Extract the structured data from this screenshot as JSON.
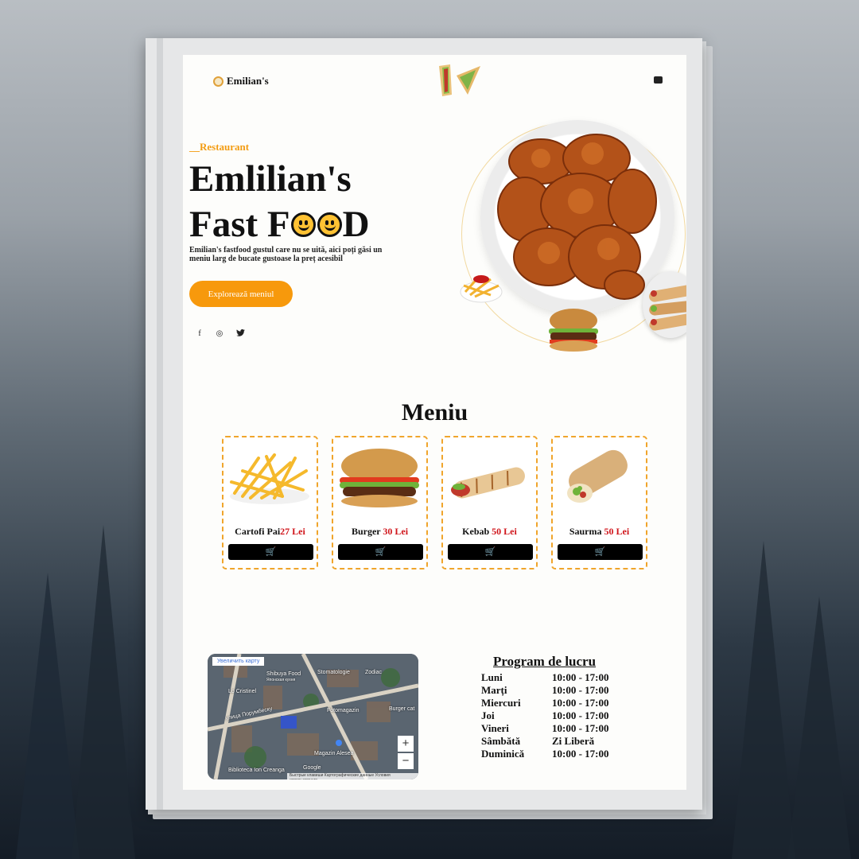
{
  "header": {
    "brand": "Emilian's"
  },
  "hero": {
    "eyebrow": "__Restaurant",
    "title_line1": "Emlilian's",
    "title_line2_start": "Fast F",
    "title_line2_end": "D",
    "description": "Emilian's fastfood gustul care nu se uită, aici poți găsi un meniu larg de bucate gustoase la preț acesibil",
    "cta_label": "Explorează meniul"
  },
  "social": {
    "facebook": "f",
    "instagram": "◎",
    "twitter": "🐦"
  },
  "menu": {
    "title": "Meniu",
    "items": [
      {
        "name": "Cartofi Pai",
        "price": "27 Lei"
      },
      {
        "name": "Burger ",
        "price": "30 Lei"
      },
      {
        "name": "Kebab ",
        "price": "50 Lei"
      },
      {
        "name": "Saurma ",
        "price": "50 Lei"
      }
    ],
    "cart_icon": "🛒"
  },
  "map": {
    "enlarge_label": "Увеличить карту",
    "labels": [
      "Shibuya Food",
      "Японская кухня",
      "Stomatologie",
      "Zodiac",
      "Lo Cristinel",
      "Fotomagazin",
      "Burger cat",
      "Magazin Alesea",
      "Biblioteca Ion Creanga",
      "Google",
      "улица Порумбеску"
    ],
    "zoom_in": "+",
    "zoom_out": "−",
    "footer": "Быстрые клавиши  Картографические данные  Условия использования"
  },
  "schedule": {
    "title": "Program de lucru",
    "rows": [
      {
        "day": "Luni",
        "hours": "10:00 - 17:00"
      },
      {
        "day": "Marți",
        "hours": "10:00 - 17:00"
      },
      {
        "day": "Miercuri",
        "hours": "10:00 - 17:00"
      },
      {
        "day": "Joi",
        "hours": "10:00 - 17:00"
      },
      {
        "day": "Vineri",
        "hours": "10:00 - 17:00"
      },
      {
        "day": "Sâmbătă",
        "hours": "Zi Liberă"
      },
      {
        "day": "Duminică",
        "hours": "10:00 - 17:00"
      }
    ]
  },
  "colors": {
    "accent": "#f7990c",
    "price": "#d0141a",
    "text": "#111111"
  }
}
